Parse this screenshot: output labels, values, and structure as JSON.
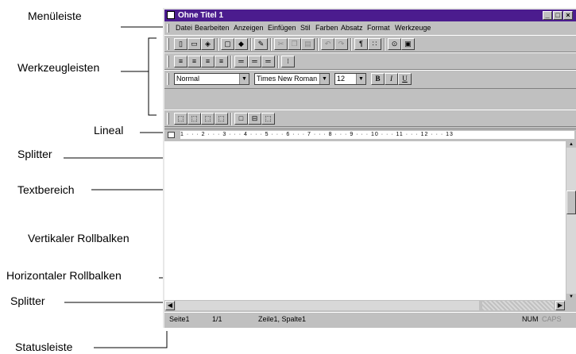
{
  "labels": {
    "menueleiste": "Menüleiste",
    "werkzeugleisten": "Werkzeugleisten",
    "lineal": "Lineal",
    "splitter_top": "Splitter",
    "textbereich": "Textbereich",
    "vertikaler": "Vertikaler Rollbalken",
    "horizontaler": "Horizontaler Rollbalken",
    "splitter_bottom": "Splitter",
    "statusleiste": "Statusleiste"
  },
  "window": {
    "title": "Ohne Titel 1",
    "menu": [
      "Datei",
      "Bearbeiten",
      "Anzeigen",
      "Einfügen",
      "Stil",
      "Farben",
      "Absatz",
      "Format",
      "Werkzeuge"
    ]
  },
  "format_bar": {
    "style": "Normal",
    "font": "Times New Roman",
    "size": "12",
    "bold": "B",
    "italic": "I",
    "underline": "U"
  },
  "ruler": {
    "scale": "1 · · · 2 · · · 3 · · · 4 · · · 5 · · · 6 · · · 7 · · · 8 · · · 9 · · · 10 · · · 11 · · · 12 · · · 13"
  },
  "status": {
    "page": "Seite1",
    "pages": "1/1",
    "position": "Zeile1, Spalte1",
    "num": "NUM",
    "caps": "CAPS"
  }
}
